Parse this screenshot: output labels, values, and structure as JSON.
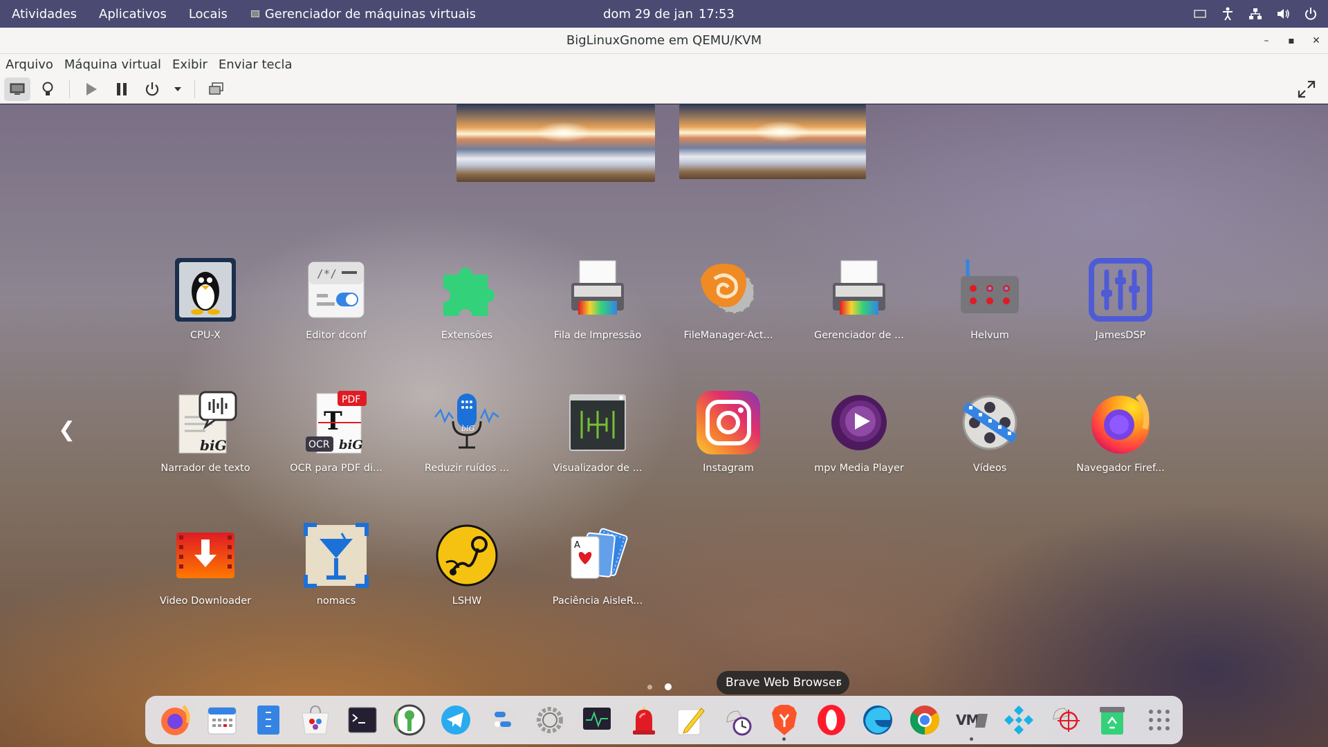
{
  "topbar": {
    "activities": "Atividades",
    "applications": "Aplicativos",
    "places": "Locais",
    "focused_app": "Gerenciador de máquinas virtuais",
    "date": "dom 29 de jan",
    "time": "17:53",
    "tray_icons": [
      "screen-icon",
      "accessibility-icon",
      "network-icon",
      "volume-icon",
      "power-icon"
    ]
  },
  "window": {
    "title": "BigLinuxGnome em QEMU/KVM",
    "controls": [
      "minimize",
      "maximize",
      "close"
    ]
  },
  "menu": {
    "items": [
      "Arquivo",
      "Máquina virtual",
      "Exibir",
      "Enviar tecla"
    ]
  },
  "toolbar": {
    "buttons": [
      "console-icon",
      "details-bulb-icon",
      "run-icon",
      "pause-icon",
      "shutdown-icon",
      "shutdown-menu-icon",
      "snapshots-icon",
      "fullscreen-icon"
    ]
  },
  "guest": {
    "apps": [
      {
        "label": "CPU-X",
        "icon": "cpu-x-icon"
      },
      {
        "label": "Editor dconf",
        "icon": "dconf-editor-icon"
      },
      {
        "label": "Extensões",
        "icon": "extensions-icon"
      },
      {
        "label": "Fila de Impressão",
        "icon": "print-queue-icon"
      },
      {
        "label": "FileManager-Act...",
        "icon": "filemanager-actions-icon"
      },
      {
        "label": "Gerenciador de ...",
        "icon": "printer-manager-icon"
      },
      {
        "label": "Helvum",
        "icon": "helvum-icon"
      },
      {
        "label": "JamesDSP",
        "icon": "jamesdsp-icon"
      },
      {
        "label": "Narrador de texto",
        "icon": "text-narrator-icon"
      },
      {
        "label": "OCR para PDF di...",
        "icon": "ocr-pdf-icon"
      },
      {
        "label": "Reduzir ruídos ...",
        "icon": "noise-reduction-icon"
      },
      {
        "label": "Visualizador de ...",
        "icon": "viewer-icon"
      },
      {
        "label": "Instagram",
        "icon": "instagram-icon"
      },
      {
        "label": "mpv Media Player",
        "icon": "mpv-icon"
      },
      {
        "label": "Vídeos",
        "icon": "videos-icon"
      },
      {
        "label": "Navegador Firef...",
        "icon": "firefox-icon"
      },
      {
        "label": "Video Downloader",
        "icon": "video-downloader-icon"
      },
      {
        "label": "nomacs",
        "icon": "nomacs-icon"
      },
      {
        "label": "LSHW",
        "icon": "lshw-icon"
      },
      {
        "label": "Paciência AisleR...",
        "icon": "solitaire-icon"
      }
    ],
    "page_count": 2,
    "current_page": 2,
    "tooltip": "Brave Web Browser",
    "tooltip_tail": "s",
    "dock": [
      "firefox-icon",
      "calendar-icon",
      "files-icon",
      "software-icon",
      "terminal-icon",
      "keepass-icon",
      "telegram-icon",
      "settings-panel-icon",
      "gear-settings-icon",
      "system-monitor-icon",
      "alarm-icon",
      "text-editor-icon",
      "clock-icon",
      "brave-icon",
      "opera-icon",
      "edge-icon",
      "chrome-icon",
      "virt-manager-icon",
      "kodi-icon",
      "screenshot-icon",
      "recycle-icon",
      "app-grid-icon"
    ]
  }
}
